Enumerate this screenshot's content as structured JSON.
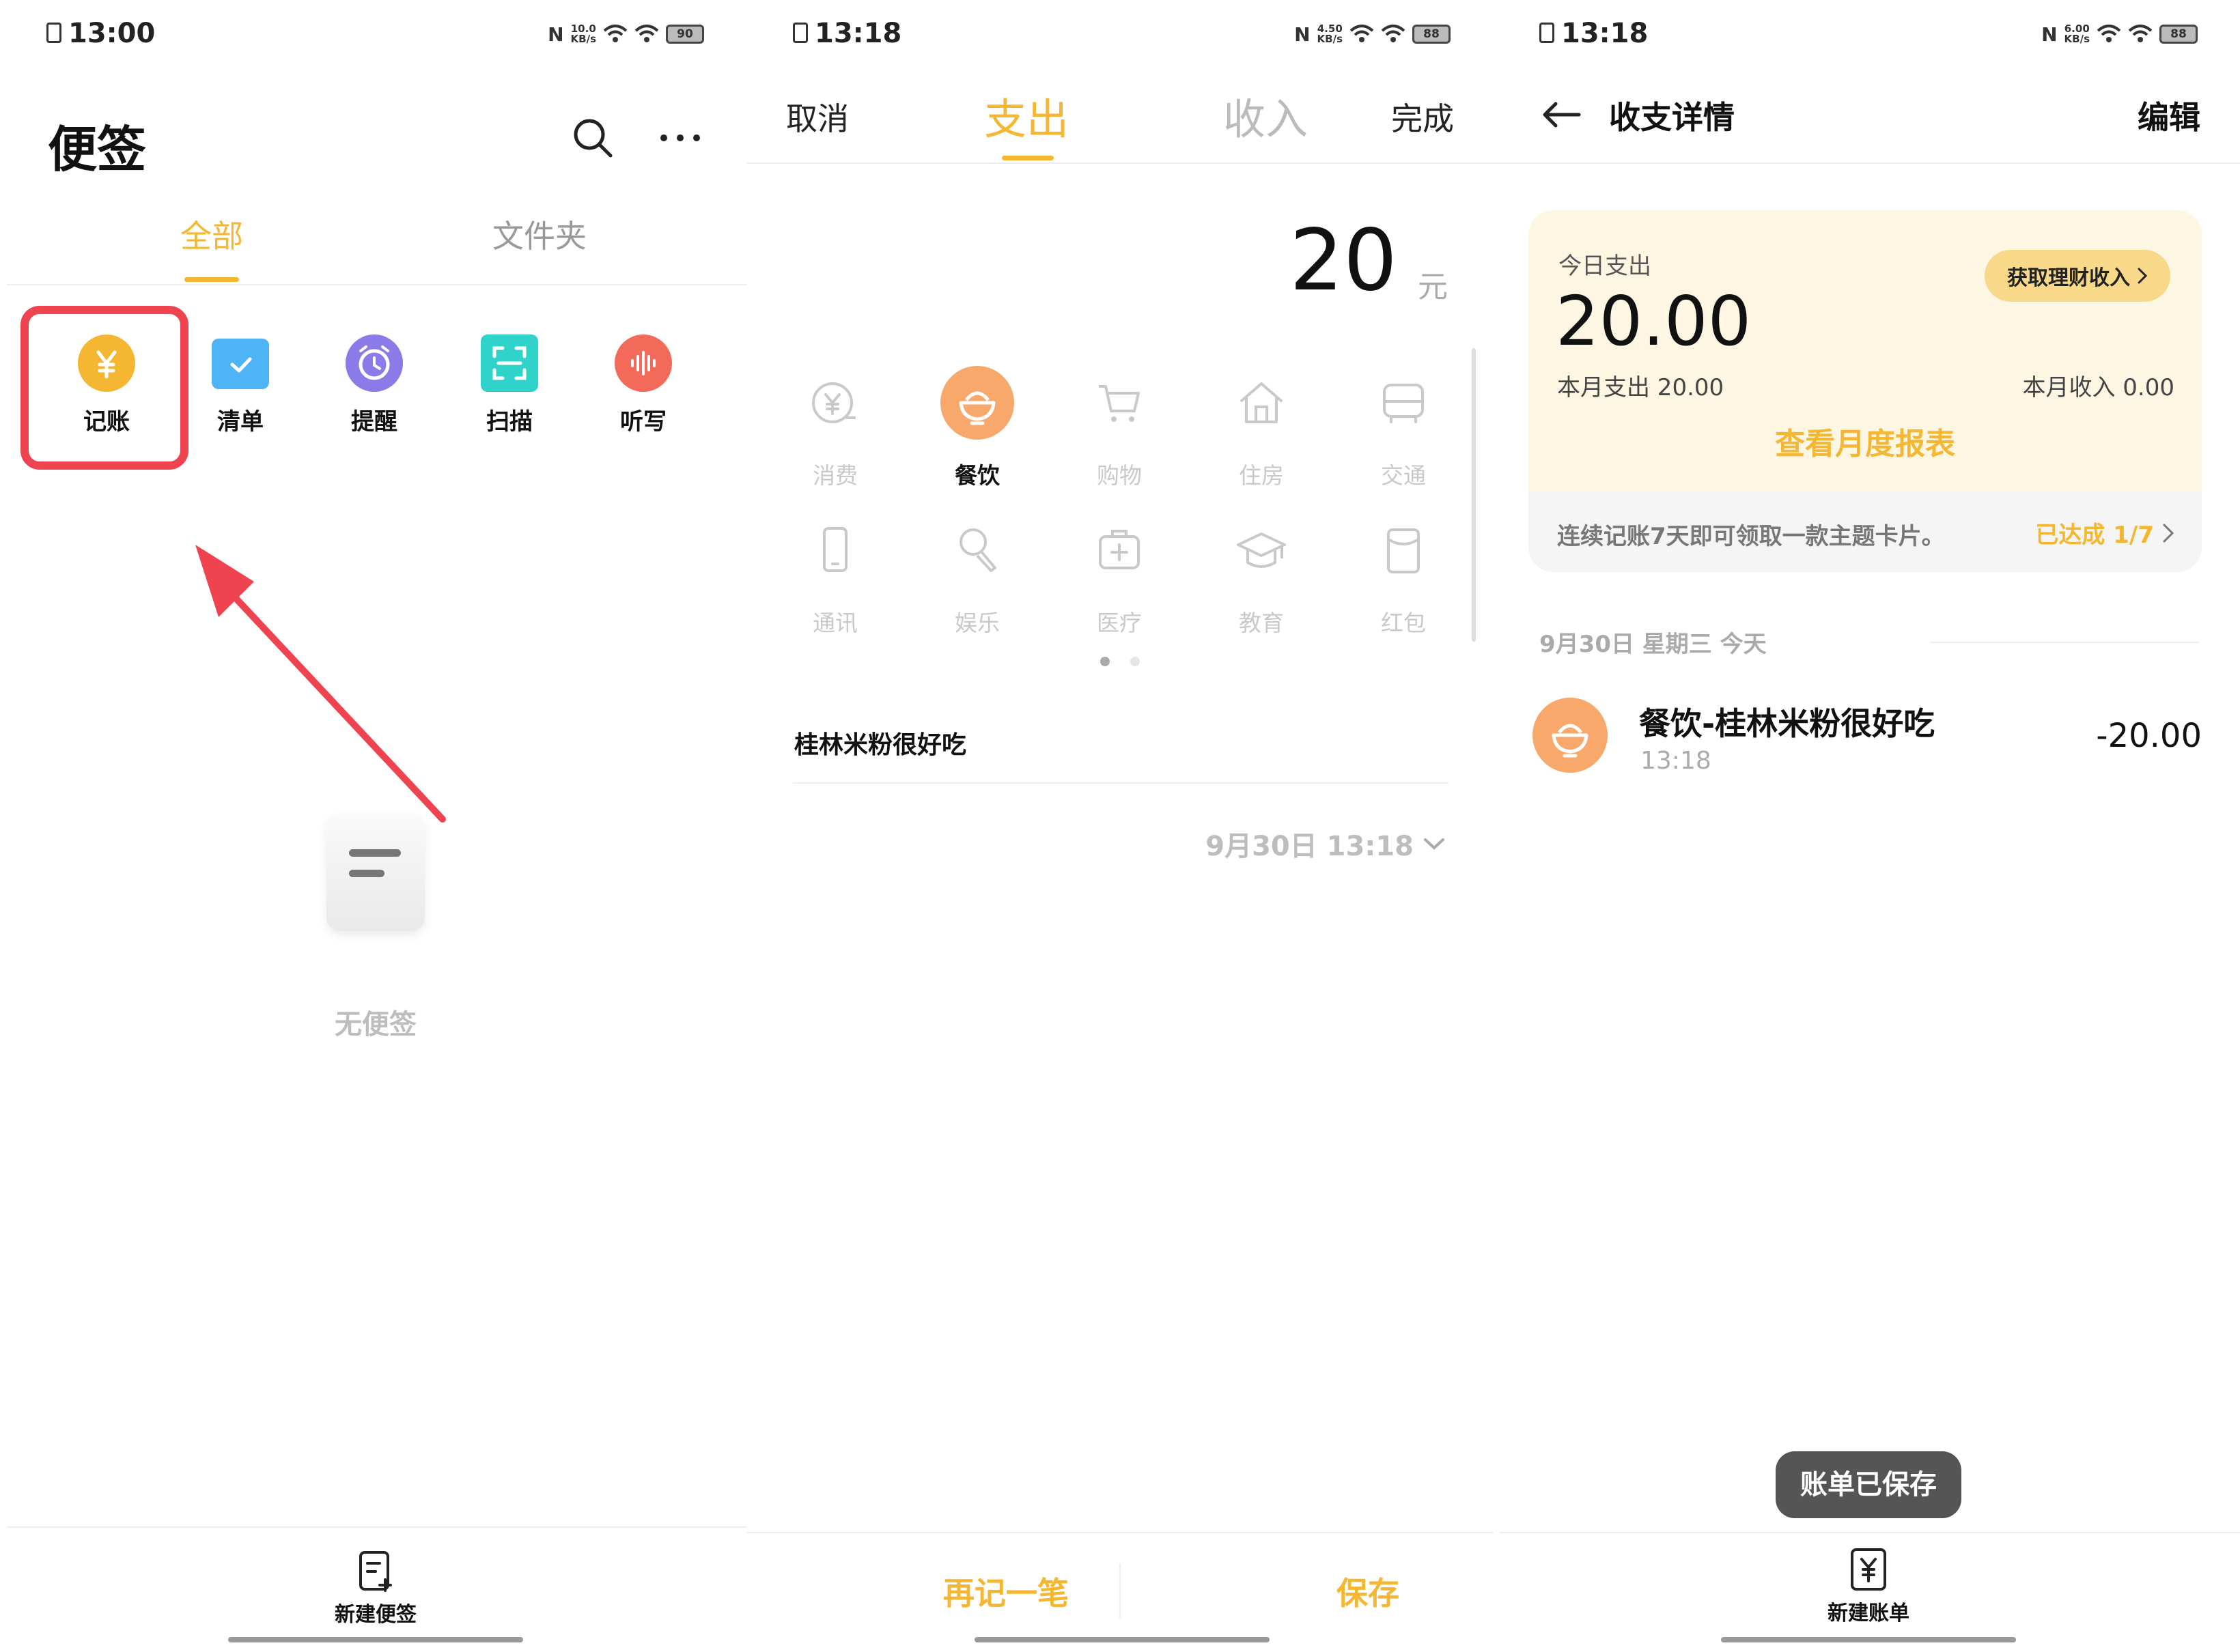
{
  "screens": [
    {
      "status": {
        "time": "13:00",
        "speed_top": "10.0",
        "speed_unit": "KB/s",
        "battery": "90"
      },
      "app_title": "便签",
      "tabs": [
        {
          "label": "全部",
          "active": true
        },
        {
          "label": "文件夹",
          "active": false
        }
      ],
      "quick_actions": [
        {
          "label": "记账",
          "icon": "yen-icon",
          "color": "#F5B731"
        },
        {
          "label": "清单",
          "icon": "checklist-icon",
          "color": "#4FB4F5"
        },
        {
          "label": "提醒",
          "icon": "alarm-clock-icon",
          "color": "#8A7BE8"
        },
        {
          "label": "扫描",
          "icon": "scan-icon",
          "color": "#2FD3C9"
        },
        {
          "label": "听写",
          "icon": "voice-wave-icon",
          "color": "#F36A5A"
        }
      ],
      "empty_text": "无便签",
      "bottom_button": "新建便签"
    },
    {
      "status": {
        "time": "13:18",
        "speed_top": "4.50",
        "speed_unit": "KB/s",
        "battery": "88"
      },
      "header": {
        "cancel": "取消",
        "tab_expense": "支出",
        "tab_income": "收入",
        "done": "完成"
      },
      "amount": "20",
      "currency": "元",
      "categories": [
        {
          "label": "消费",
          "icon": "yen-minus-icon",
          "active": false
        },
        {
          "label": "餐饮",
          "icon": "rice-bowl-icon",
          "active": true
        },
        {
          "label": "购物",
          "icon": "shopping-cart-icon",
          "active": false
        },
        {
          "label": "住房",
          "icon": "house-icon",
          "active": false
        },
        {
          "label": "交通",
          "icon": "bus-icon",
          "active": false
        },
        {
          "label": "通讯",
          "icon": "phone-icon",
          "active": false
        },
        {
          "label": "娱乐",
          "icon": "microphone-icon",
          "active": false
        },
        {
          "label": "医疗",
          "icon": "medical-kit-icon",
          "active": false
        },
        {
          "label": "教育",
          "icon": "graduation-cap-icon",
          "active": false
        },
        {
          "label": "红包",
          "icon": "red-packet-icon",
          "active": false
        }
      ],
      "note": "桂林米粉很好吃",
      "datetime": "9月30日 13:18",
      "footer": {
        "again": "再记一笔",
        "save": "保存"
      },
      "accent": "#F5B731"
    },
    {
      "status": {
        "time": "13:18",
        "speed_top": "6.00",
        "speed_unit": "KB/s",
        "battery": "88"
      },
      "header": {
        "title": "收支详情",
        "edit": "编辑"
      },
      "summary": {
        "today_label": "今日支出",
        "today_amount": "20.00",
        "finance_button": "获取理财收入",
        "month_expense": "本月支出 20.00",
        "month_income": "本月收入 0.00",
        "report_link": "查看月度报表",
        "streak_text": "连续记账7天即可领取一款主题卡片。",
        "streak_progress": "已达成 1/7"
      },
      "date_header": "9月30日 星期三 今天",
      "entries": [
        {
          "title": "餐饮-桂林米粉很好吃",
          "time": "13:18",
          "amount": "-20.00",
          "icon": "rice-bowl-icon"
        }
      ],
      "toast": "账单已保存",
      "bottom_button": "新建账单"
    }
  ]
}
